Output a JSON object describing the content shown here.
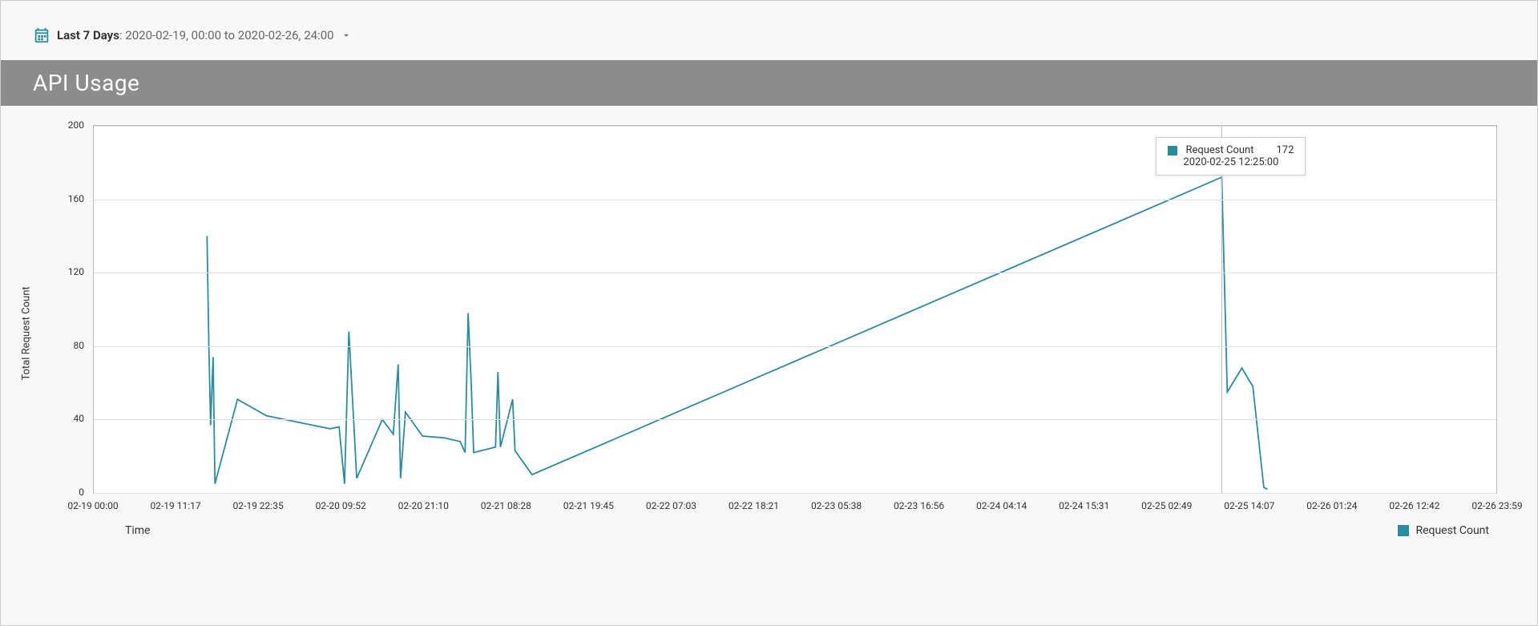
{
  "date_picker": {
    "label": "Last 7 Days",
    "range_text": ": 2020-02-19, 00:00 to 2020-02-26, 24:00"
  },
  "section_title": "API Usage",
  "chart_data": {
    "type": "line",
    "title": "",
    "xlabel": "Time",
    "ylabel": "Total Request Count",
    "ylim": [
      0,
      200
    ],
    "y_ticks": [
      0,
      40,
      80,
      120,
      160,
      200
    ],
    "x_tick_labels": [
      "02-19 00:00",
      "02-19 11:17",
      "02-19 22:35",
      "02-20 09:52",
      "02-20 21:10",
      "02-21 08:28",
      "02-21 19:45",
      "02-22 07:03",
      "02-22 18:21",
      "02-23 05:38",
      "02-23 16:56",
      "02-24 04:14",
      "02-24 15:31",
      "02-25 02:49",
      "02-25 14:07",
      "02-26 01:24",
      "02-26 12:42",
      "02-26 23:59"
    ],
    "x_range_minutes": [
      0,
      11520
    ],
    "series": [
      {
        "name": "Request Count",
        "color": "#2a8ca0",
        "points": [
          {
            "t": 930,
            "v": 140
          },
          {
            "t": 945,
            "v": 80
          },
          {
            "t": 960,
            "v": 37
          },
          {
            "t": 980,
            "v": 74
          },
          {
            "t": 995,
            "v": 5
          },
          {
            "t": 1180,
            "v": 51
          },
          {
            "t": 1420,
            "v": 42
          },
          {
            "t": 1940,
            "v": 35
          },
          {
            "t": 2015,
            "v": 36
          },
          {
            "t": 2060,
            "v": 5
          },
          {
            "t": 2095,
            "v": 88
          },
          {
            "t": 2160,
            "v": 8
          },
          {
            "t": 2370,
            "v": 40
          },
          {
            "t": 2460,
            "v": 32
          },
          {
            "t": 2500,
            "v": 70
          },
          {
            "t": 2520,
            "v": 8
          },
          {
            "t": 2560,
            "v": 44
          },
          {
            "t": 2700,
            "v": 31
          },
          {
            "t": 2880,
            "v": 30
          },
          {
            "t": 3010,
            "v": 28
          },
          {
            "t": 3050,
            "v": 22
          },
          {
            "t": 3075,
            "v": 98
          },
          {
            "t": 3100,
            "v": 60
          },
          {
            "t": 3120,
            "v": 22
          },
          {
            "t": 3300,
            "v": 25
          },
          {
            "t": 3320,
            "v": 66
          },
          {
            "t": 3340,
            "v": 25
          },
          {
            "t": 3440,
            "v": 51
          },
          {
            "t": 3460,
            "v": 23
          },
          {
            "t": 3600,
            "v": 10
          },
          {
            "t": 9265,
            "v": 172
          },
          {
            "t": 9310,
            "v": 55
          },
          {
            "t": 9430,
            "v": 68
          },
          {
            "t": 9520,
            "v": 58
          },
          {
            "t": 9610,
            "v": 3
          },
          {
            "t": 9640,
            "v": 2
          }
        ]
      }
    ],
    "tooltip": {
      "series_label": "Request Count",
      "value": "172",
      "timestamp": "2020-02-25 12:25:00",
      "at_t": 9265,
      "at_v": 172
    },
    "legend": {
      "position": "bottom-right",
      "entries": [
        "Request Count"
      ]
    }
  }
}
